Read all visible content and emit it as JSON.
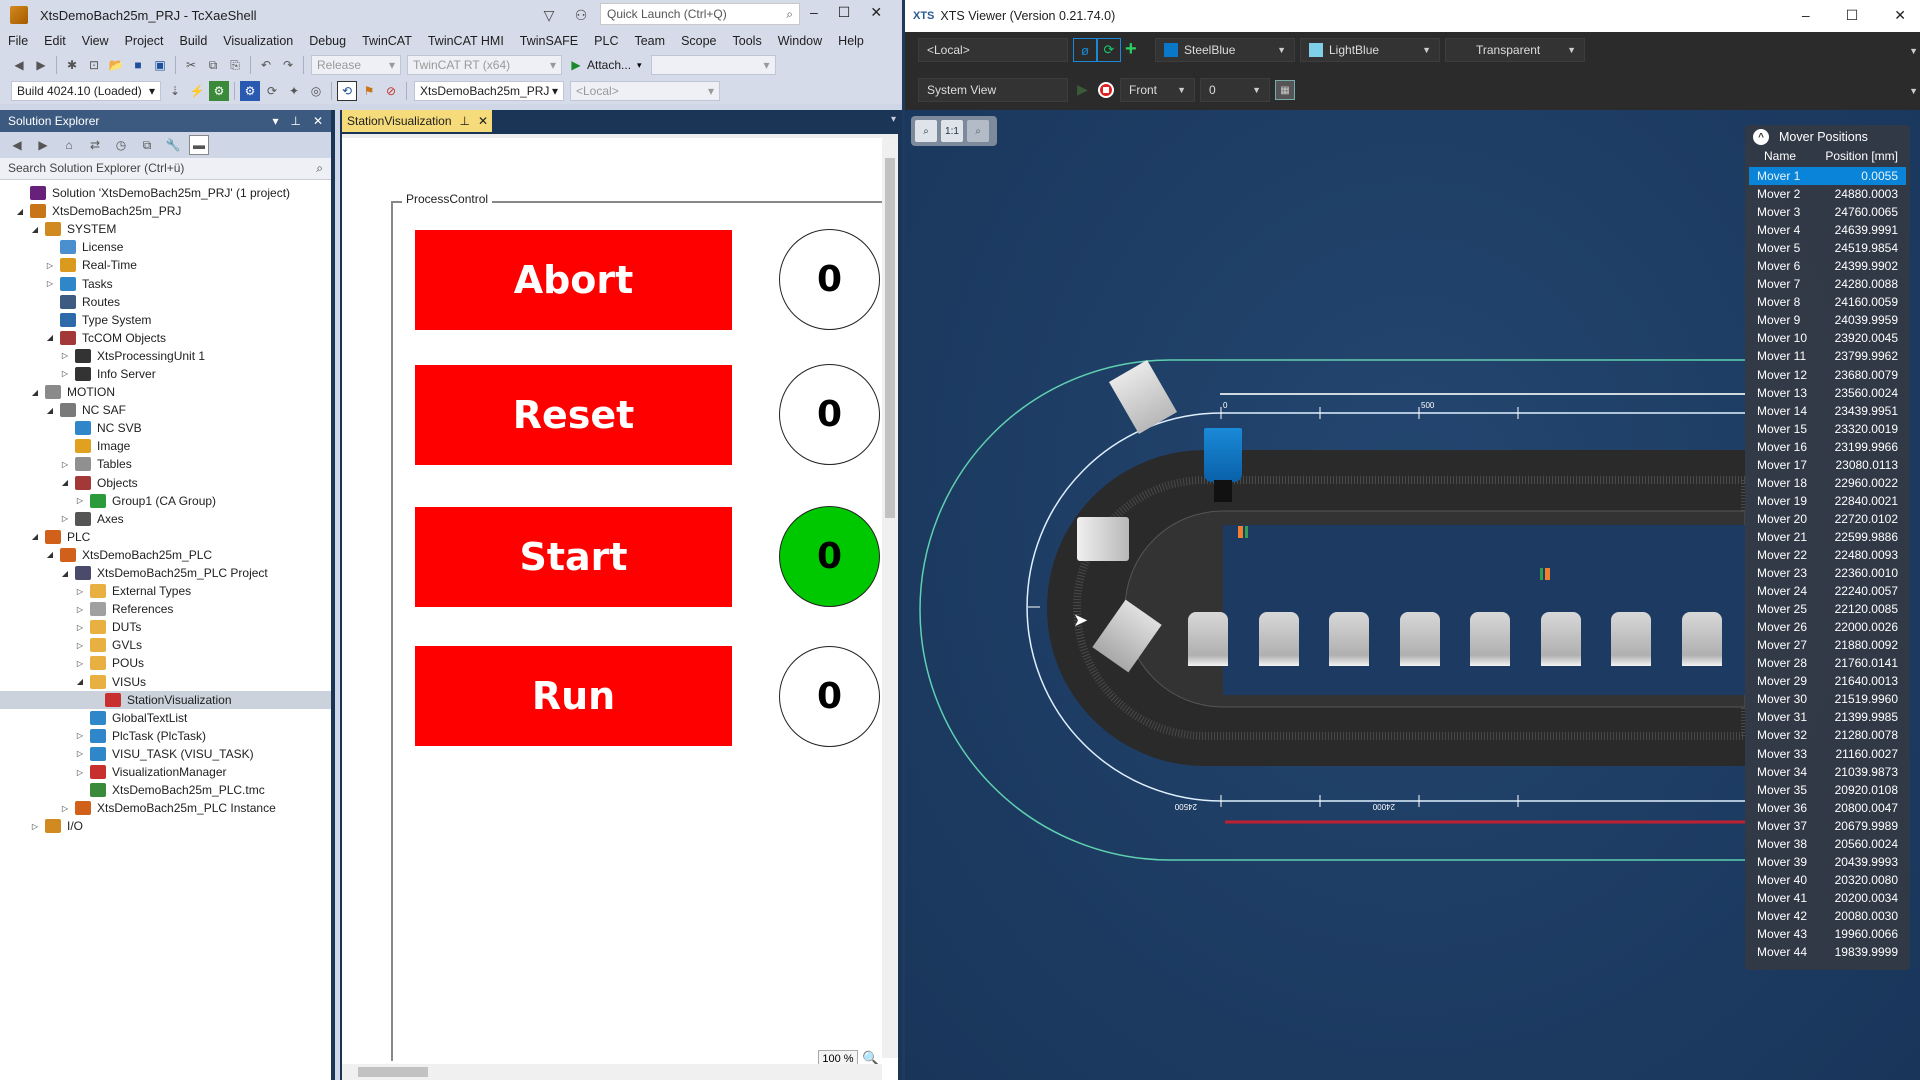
{
  "ide": {
    "title": "XtsDemoBach25m_PRJ - TcXaeShell",
    "quick_launch_placeholder": "Quick Launch (Ctrl+Q)",
    "menu": [
      "File",
      "Edit",
      "View",
      "Project",
      "Build",
      "Visualization",
      "Debug",
      "TwinCAT",
      "TwinCAT HMI",
      "TwinSAFE",
      "PLC",
      "Team",
      "Scope",
      "Tools",
      "Window",
      "Help"
    ],
    "toolbar": {
      "configuration": "Release",
      "platform": "TwinCAT RT (x64)",
      "attach_label": "Attach...",
      "build_version": "Build 4024.10 (Loaded)",
      "project": "XtsDemoBach25m_PRJ",
      "target": "<Local>"
    }
  },
  "solution_explorer": {
    "title": "Solution Explorer",
    "search_placeholder": "Search Solution Explorer (Ctrl+ü)",
    "tree": [
      {
        "label": "Solution 'XtsDemoBach25m_PRJ' (1 project)",
        "level": 0,
        "expander": "",
        "icon": "solution-icon",
        "color": "#68217a"
      },
      {
        "label": "XtsDemoBach25m_PRJ",
        "level": 0,
        "expander": "open",
        "icon": "twincat-project-icon",
        "color": "#c8751a"
      },
      {
        "label": "SYSTEM",
        "level": 1,
        "expander": "open",
        "icon": "system-icon",
        "color": "#d08a20"
      },
      {
        "label": "License",
        "level": 2,
        "expander": "",
        "icon": "license-icon",
        "color": "#4a8fd0"
      },
      {
        "label": "Real-Time",
        "level": 2,
        "expander": "closed",
        "icon": "realtime-icon",
        "color": "#d99a1e"
      },
      {
        "label": "Tasks",
        "level": 2,
        "expander": "closed",
        "icon": "tasks-icon",
        "color": "#2f86c9"
      },
      {
        "label": "Routes",
        "level": 2,
        "expander": "",
        "icon": "routes-icon",
        "color": "#3d5a80"
      },
      {
        "label": "Type System",
        "level": 2,
        "expander": "",
        "icon": "type-system-icon",
        "color": "#2e6aa8"
      },
      {
        "label": "TcCOM Objects",
        "level": 2,
        "expander": "open",
        "icon": "tccom-icon",
        "color": "#a33838"
      },
      {
        "label": "XtsProcessingUnit 1",
        "level": 3,
        "expander": "closed",
        "icon": "module-icon",
        "color": "#333333"
      },
      {
        "label": "Info Server",
        "level": 3,
        "expander": "closed",
        "icon": "module-icon",
        "color": "#333333"
      },
      {
        "label": "MOTION",
        "level": 1,
        "expander": "open",
        "icon": "motion-icon",
        "color": "#8a8a8a"
      },
      {
        "label": "NC SAF",
        "level": 2,
        "expander": "open",
        "icon": "nc-saf-icon",
        "color": "#7a7a7a"
      },
      {
        "label": "NC SVB",
        "level": 3,
        "expander": "",
        "icon": "nc-svb-icon",
        "color": "#2f86c9"
      },
      {
        "label": "Image",
        "level": 3,
        "expander": "",
        "icon": "image-icon",
        "color": "#e0a020"
      },
      {
        "label": "Tables",
        "level": 3,
        "expander": "closed",
        "icon": "tables-icon",
        "color": "#909090"
      },
      {
        "label": "Objects",
        "level": 3,
        "expander": "open",
        "icon": "objects-icon",
        "color": "#a33838"
      },
      {
        "label": "Group1 (CA Group)",
        "level": 4,
        "expander": "closed",
        "icon": "group-icon",
        "color": "#2a9a3a"
      },
      {
        "label": "Axes",
        "level": 3,
        "expander": "closed",
        "icon": "axes-icon",
        "color": "#555555"
      },
      {
        "label": "PLC",
        "level": 1,
        "expander": "open",
        "icon": "plc-icon",
        "color": "#d0601a"
      },
      {
        "label": "XtsDemoBach25m_PLC",
        "level": 2,
        "expander": "open",
        "icon": "plc-project-icon",
        "color": "#d0601a"
      },
      {
        "label": "XtsDemoBach25m_PLC Project",
        "level": 3,
        "expander": "open",
        "icon": "plc-code-icon",
        "color": "#4a4a6a"
      },
      {
        "label": "External Types",
        "level": 4,
        "expander": "closed",
        "icon": "folder-icon",
        "color": "#e8b040"
      },
      {
        "label": "References",
        "level": 4,
        "expander": "closed",
        "icon": "references-icon",
        "color": "#a0a0a0"
      },
      {
        "label": "DUTs",
        "level": 4,
        "expander": "closed",
        "icon": "folder-icon",
        "color": "#e8b040"
      },
      {
        "label": "GVLs",
        "level": 4,
        "expander": "closed",
        "icon": "folder-icon",
        "color": "#e8b040"
      },
      {
        "label": "POUs",
        "level": 4,
        "expander": "closed",
        "icon": "folder-icon",
        "color": "#e8b040"
      },
      {
        "label": "VISUs",
        "level": 4,
        "expander": "open",
        "icon": "folder-open-icon",
        "color": "#e8b040"
      },
      {
        "label": "StationVisualization",
        "level": 5,
        "expander": "",
        "icon": "visualization-icon",
        "color": "#c83030",
        "selected": true
      },
      {
        "label": "GlobalTextList",
        "level": 4,
        "expander": "",
        "icon": "textlist-icon",
        "color": "#2f86c9"
      },
      {
        "label": "PlcTask (PlcTask)",
        "level": 4,
        "expander": "closed",
        "icon": "task-icon",
        "color": "#2f86c9"
      },
      {
        "label": "VISU_TASK (VISU_TASK)",
        "level": 4,
        "expander": "closed",
        "icon": "task-icon",
        "color": "#2f86c9"
      },
      {
        "label": "VisualizationManager",
        "level": 4,
        "expander": "closed",
        "icon": "visu-manager-icon",
        "color": "#c83030"
      },
      {
        "label": "XtsDemoBach25m_PLC.tmc",
        "level": 4,
        "expander": "",
        "icon": "tmc-icon",
        "color": "#3a8a3a"
      },
      {
        "label": "XtsDemoBach25m_PLC Instance",
        "level": 3,
        "expander": "closed",
        "icon": "plc-instance-icon",
        "color": "#d0601a"
      },
      {
        "label": "I/O",
        "level": 1,
        "expander": "closed",
        "icon": "io-icon",
        "color": "#d08a20"
      }
    ]
  },
  "document": {
    "tab_label": "StationVisualization",
    "group_label": "ProcessControl",
    "zoom": "100 %",
    "controls": [
      {
        "label": "Abort",
        "lamp_value": "0",
        "lamp_color": "#ffffff"
      },
      {
        "label": "Reset",
        "lamp_value": "0",
        "lamp_color": "#ffffff"
      },
      {
        "label": "Start",
        "lamp_value": "0",
        "lamp_color": "#00c800"
      },
      {
        "label": "Run",
        "lamp_value": "0",
        "lamp_color": "#ffffff"
      }
    ]
  },
  "xts_viewer": {
    "title": "XTS Viewer (Version 0.21.74.0)",
    "target": "<Local>",
    "color1": {
      "label": "SteelBlue",
      "hex": "#0a78c8"
    },
    "color2": {
      "label": "LightBlue",
      "hex": "#7fd0e8"
    },
    "background": "Transparent",
    "view": "System View",
    "orientation": "Front",
    "index": "0",
    "ruler_labels": {
      "top_0": "0",
      "top_500": "500",
      "bottom_24500": "24500",
      "bottom_24000": "24000"
    },
    "mover_panel": {
      "title": "Mover Positions",
      "col_name": "Name",
      "col_position": "Position [mm]",
      "movers": [
        {
          "name": "Mover 1",
          "pos": "0.0055",
          "selected": true
        },
        {
          "name": "Mover 2",
          "pos": "24880.0003"
        },
        {
          "name": "Mover 3",
          "pos": "24760.0065"
        },
        {
          "name": "Mover 4",
          "pos": "24639.9991"
        },
        {
          "name": "Mover 5",
          "pos": "24519.9854"
        },
        {
          "name": "Mover 6",
          "pos": "24399.9902"
        },
        {
          "name": "Mover 7",
          "pos": "24280.0088"
        },
        {
          "name": "Mover 8",
          "pos": "24160.0059"
        },
        {
          "name": "Mover 9",
          "pos": "24039.9959"
        },
        {
          "name": "Mover 10",
          "pos": "23920.0045"
        },
        {
          "name": "Mover 11",
          "pos": "23799.9962"
        },
        {
          "name": "Mover 12",
          "pos": "23680.0079"
        },
        {
          "name": "Mover 13",
          "pos": "23560.0024"
        },
        {
          "name": "Mover 14",
          "pos": "23439.9951"
        },
        {
          "name": "Mover 15",
          "pos": "23320.0019"
        },
        {
          "name": "Mover 16",
          "pos": "23199.9966"
        },
        {
          "name": "Mover 17",
          "pos": "23080.0113"
        },
        {
          "name": "Mover 18",
          "pos": "22960.0022"
        },
        {
          "name": "Mover 19",
          "pos": "22840.0021"
        },
        {
          "name": "Mover 20",
          "pos": "22720.0102"
        },
        {
          "name": "Mover 21",
          "pos": "22599.9886"
        },
        {
          "name": "Mover 22",
          "pos": "22480.0093"
        },
        {
          "name": "Mover 23",
          "pos": "22360.0010"
        },
        {
          "name": "Mover 24",
          "pos": "22240.0057"
        },
        {
          "name": "Mover 25",
          "pos": "22120.0085"
        },
        {
          "name": "Mover 26",
          "pos": "22000.0026"
        },
        {
          "name": "Mover 27",
          "pos": "21880.0092"
        },
        {
          "name": "Mover 28",
          "pos": "21760.0141"
        },
        {
          "name": "Mover 29",
          "pos": "21640.0013"
        },
        {
          "name": "Mover 30",
          "pos": "21519.9960"
        },
        {
          "name": "Mover 31",
          "pos": "21399.9985"
        },
        {
          "name": "Mover 32",
          "pos": "21280.0078"
        },
        {
          "name": "Mover 33",
          "pos": "21160.0027"
        },
        {
          "name": "Mover 34",
          "pos": "21039.9873"
        },
        {
          "name": "Mover 35",
          "pos": "20920.0108"
        },
        {
          "name": "Mover 36",
          "pos": "20800.0047"
        },
        {
          "name": "Mover 37",
          "pos": "20679.9989"
        },
        {
          "name": "Mover 38",
          "pos": "20560.0024"
        },
        {
          "name": "Mover 39",
          "pos": "20439.9993"
        },
        {
          "name": "Mover 40",
          "pos": "20320.0080"
        },
        {
          "name": "Mover 41",
          "pos": "20200.0034"
        },
        {
          "name": "Mover 42",
          "pos": "20080.0030"
        },
        {
          "name": "Mover 43",
          "pos": "19960.0066"
        },
        {
          "name": "Mover 44",
          "pos": "19839.9999"
        }
      ]
    }
  }
}
